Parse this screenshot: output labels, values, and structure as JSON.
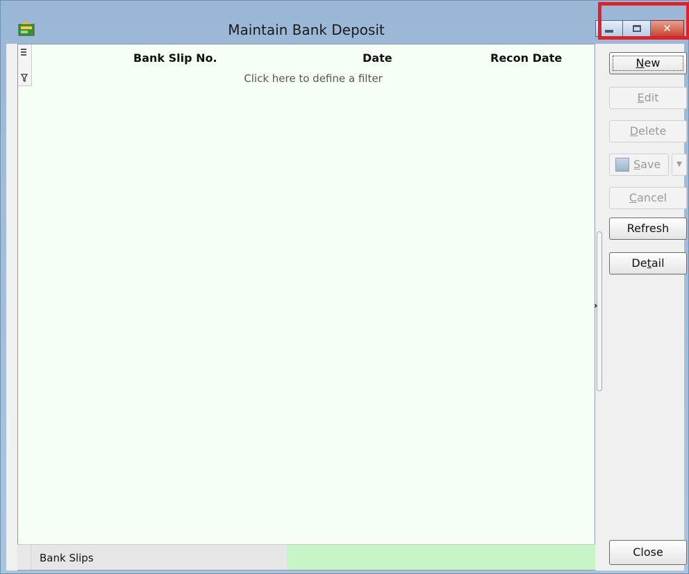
{
  "window": {
    "title": "Maintain Bank Deposit",
    "close_glyph": "✕"
  },
  "grid": {
    "columns": [
      "Bank Slip No.",
      "Date",
      "Recon Date"
    ],
    "filter_hint": "Click here to define a filter"
  },
  "status": {
    "label": "Bank Slips"
  },
  "buttons": {
    "new": {
      "pre": "",
      "key": "N",
      "post": "ew"
    },
    "edit": {
      "pre": "",
      "key": "E",
      "post": "dit"
    },
    "delete": {
      "pre": "",
      "key": "D",
      "post": "elete"
    },
    "save": {
      "pre": "",
      "key": "S",
      "post": "ave"
    },
    "save_dropdown": "▼",
    "cancel": {
      "pre": "",
      "key": "C",
      "post": "ancel"
    },
    "refresh": "Refresh",
    "detail": {
      "pre": "De",
      "key": "t",
      "post": "ail"
    },
    "close": "Close"
  },
  "splitter": {
    "arrow": "›"
  },
  "colors": {
    "highlight": "#e0202a",
    "grid_background": "#f5fff5",
    "progress": "#c8f5c8"
  },
  "icons": [
    "app-icon",
    "column-chooser-icon",
    "filter-icon",
    "save-icon",
    "minimize-icon",
    "maximize-icon",
    "close-icon"
  ]
}
